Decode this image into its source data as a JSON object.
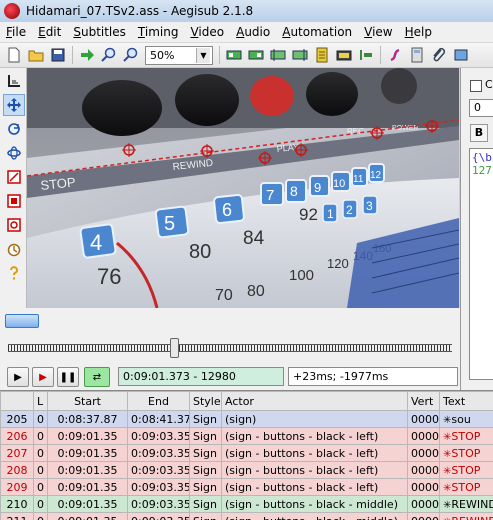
{
  "window": {
    "title": "Hidamari_07.TSv2.ass - Aegisub 2.1.8"
  },
  "menu": [
    {
      "label": "File",
      "acc": "F",
      "rest": "ile"
    },
    {
      "label": "Edit",
      "acc": "E",
      "rest": "dit"
    },
    {
      "label": "Subtitles",
      "acc": "S",
      "rest": "ubtitles"
    },
    {
      "label": "Timing",
      "acc": "T",
      "rest": "iming"
    },
    {
      "label": "Video",
      "acc": "V",
      "rest": "ideo"
    },
    {
      "label": "Audio",
      "acc": "A",
      "rest": "udio"
    },
    {
      "label": "Automation",
      "acc": "A",
      "rest": "utomation"
    },
    {
      "label": "View",
      "acc": "V",
      "rest": "iew"
    },
    {
      "label": "Help",
      "acc": "H",
      "rest": "elp"
    }
  ],
  "toolbar": {
    "zoom_value": "50%"
  },
  "right_panel": {
    "comment_label": "Co",
    "layer_value": "0",
    "bold_label": "B",
    "text_line1": "{\\bi",
    "text_line2": "127"
  },
  "controls": {
    "current_time": "0:09:01.373 - 12980",
    "offset": "+23ms; -1977ms"
  },
  "grid": {
    "headers": [
      "",
      "L",
      "Start",
      "End",
      "Style",
      "Actor",
      "Vert",
      "Text"
    ],
    "rows": [
      {
        "n": "205",
        "l": "0",
        "start": "0:08:37.87",
        "end": "0:08:41.37",
        "style": "Sign",
        "actor": "(sign)",
        "vert": "0000",
        "text": "sou",
        "state": "sel"
      },
      {
        "n": "206",
        "l": "0",
        "start": "0:09:01.35",
        "end": "0:09:03.35",
        "style": "Sign",
        "actor": "(sign - buttons - black - left)",
        "vert": "0000",
        "text": "STOP",
        "state": "red"
      },
      {
        "n": "207",
        "l": "0",
        "start": "0:09:01.35",
        "end": "0:09:03.35",
        "style": "Sign",
        "actor": "(sign - buttons - black - left)",
        "vert": "0000",
        "text": "STOP",
        "state": "red"
      },
      {
        "n": "208",
        "l": "0",
        "start": "0:09:01.35",
        "end": "0:09:03.35",
        "style": "Sign",
        "actor": "(sign - buttons - black - left)",
        "vert": "0000",
        "text": "STOP",
        "state": "red"
      },
      {
        "n": "209",
        "l": "0",
        "start": "0:09:01.35",
        "end": "0:09:03.35",
        "style": "Sign",
        "actor": "(sign - buttons - black - left)",
        "vert": "0000",
        "text": "STOP",
        "state": "red"
      },
      {
        "n": "210",
        "l": "0",
        "start": "0:09:01.35",
        "end": "0:09:03.35",
        "style": "Sign",
        "actor": "(sign - buttons - black - middle)",
        "vert": "0000",
        "text": "REWIND",
        "state": "green"
      },
      {
        "n": "211",
        "l": "0",
        "start": "0:09:01.35",
        "end": "0:09:03.35",
        "style": "Sign",
        "actor": "(sign - buttons - black - middle)",
        "vert": "0000",
        "text": "REWIND",
        "state": "pale"
      }
    ]
  },
  "video": {
    "labels": [
      "STOP",
      "REWIND",
      "PLAY",
      "REC",
      "POWER",
      "4",
      "5",
      "6",
      "7",
      "8",
      "9",
      "10",
      "11",
      "12",
      "76",
      "80",
      "84",
      "92",
      "1",
      "2",
      "3",
      "100",
      "120",
      "140",
      "160",
      "70",
      "80"
    ]
  }
}
